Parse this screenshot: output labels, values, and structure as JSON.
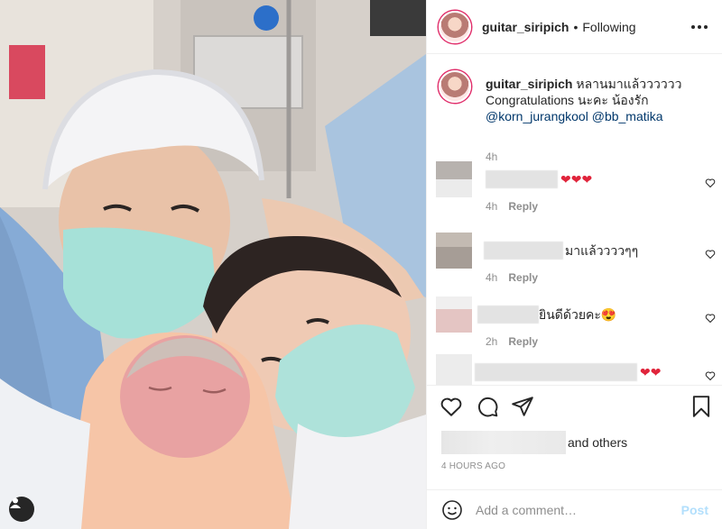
{
  "post": {
    "username": "guitar_siripich",
    "follow_state": "Following",
    "dot": "•",
    "caption": {
      "username": "guitar_siripich",
      "text_line1": "หลานมาแล้วววววว",
      "text_line2": "Congratulations นะคะ น้องรัก",
      "mention1": "@korn_jurangkool",
      "mention2": "@bb_matika",
      "time": "4h"
    },
    "comments": [
      {
        "text": "❤❤❤",
        "time": "4h",
        "reply_label": "Reply"
      },
      {
        "text": "มาแล้ววววๆๆ",
        "time": "4h",
        "reply_label": "Reply"
      },
      {
        "text": "ยินดีด้วยคะ😍",
        "time": "2h",
        "reply_label": "Reply"
      },
      {
        "text": "❤❤",
        "time": "",
        "reply_label": ""
      }
    ],
    "likes_suffix": "and others",
    "posted_time": "4 HOURS AGO",
    "add_comment_placeholder": "Add a comment…",
    "post_label": "Post"
  },
  "icons": {
    "more": "more-options-icon",
    "like": "heart-icon",
    "comment": "comment-icon",
    "share": "share-icon",
    "save": "bookmark-icon",
    "user_tag": "user-tag-icon"
  },
  "colors": {
    "link": "#00376b",
    "meta": "#8e8e8e",
    "post_disabled": "#b2dffc",
    "heart": "#ed4956"
  }
}
